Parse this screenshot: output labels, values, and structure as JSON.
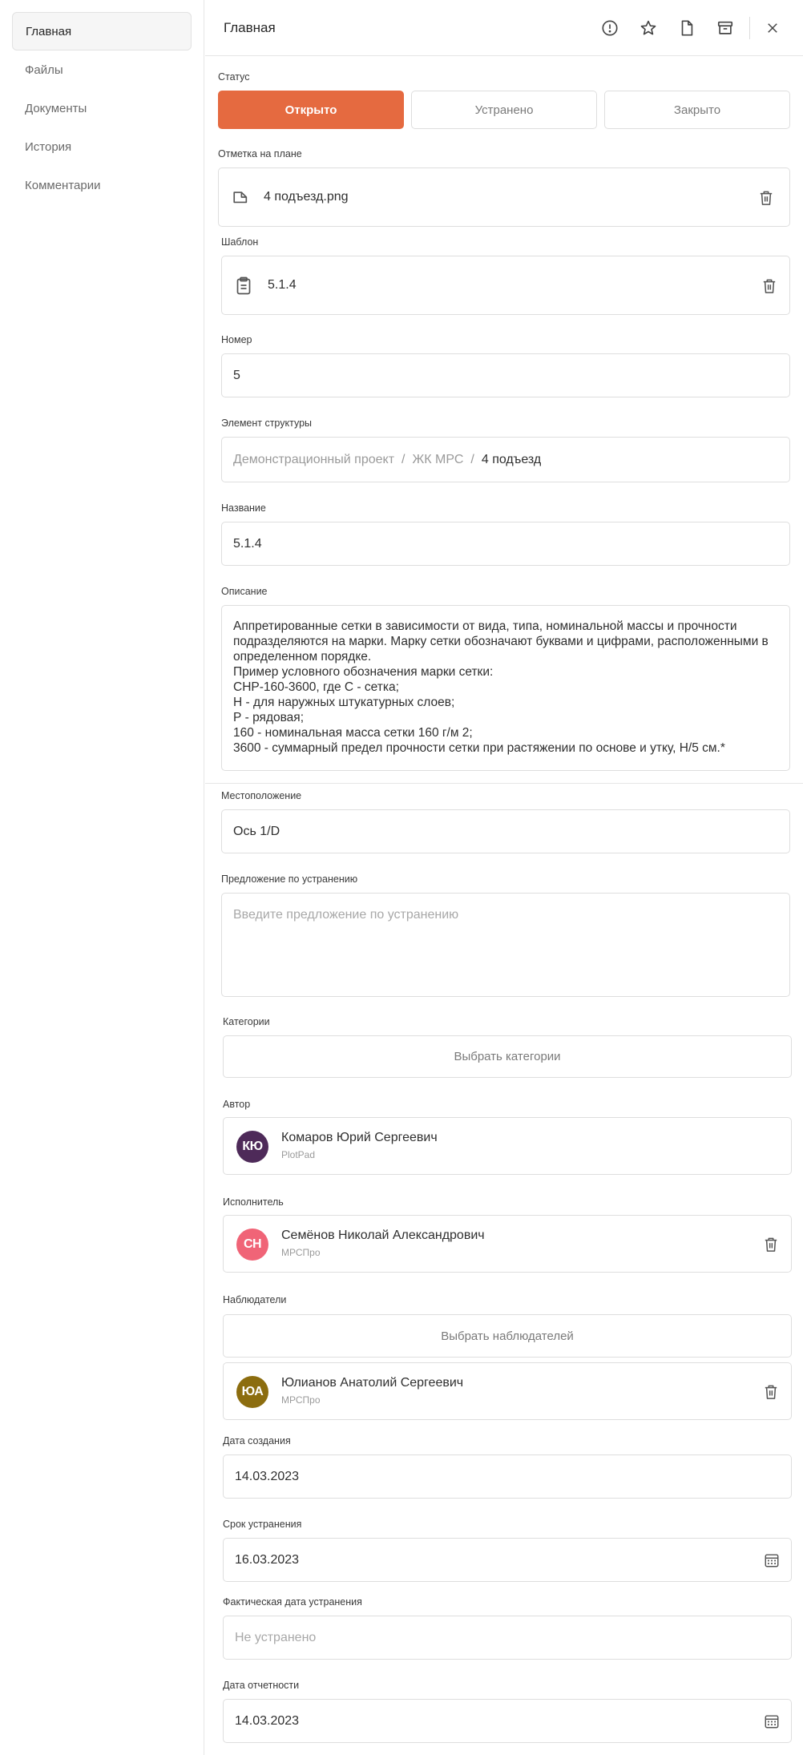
{
  "sidebar": {
    "items": [
      {
        "label": "Главная"
      },
      {
        "label": "Файлы"
      },
      {
        "label": "Документы"
      },
      {
        "label": "История"
      },
      {
        "label": "Комментарии"
      }
    ]
  },
  "header": {
    "title": "Главная",
    "icons": [
      "alert-circle-icon",
      "star-icon",
      "file-icon",
      "archive-icon",
      "close-icon"
    ]
  },
  "form": {
    "status": {
      "label": "Статус",
      "options": [
        "Открыто",
        "Устранено",
        "Закрыто"
      ],
      "selected": "Открыто"
    },
    "plan_mark": {
      "label": "Отметка на плане",
      "file": "4 подъезд.png"
    },
    "template": {
      "label": "Шаблон",
      "value": "5.1.4"
    },
    "number": {
      "label": "Номер",
      "value": "5"
    },
    "structure": {
      "label": "Элемент структуры",
      "path": [
        "Демонстрационный проект",
        "ЖК МРС",
        "4 подъезд"
      ],
      "separator": "/"
    },
    "name": {
      "label": "Название",
      "value": "5.1.4"
    },
    "description": {
      "label": "Описание",
      "value": "Аппретированные сетки в зависимости от вида, типа, номинальной массы и прочности подразделяются на марки. Марку сетки обозначают буквами и цифрами, расположенными в определенном порядке.\nПример условного обозначения марки сетки:\nСНР-160-3600, где С - сетка;\nН - для наружных штукатурных слоев;\nР - рядовая;\n160 - номинальная масса сетки 160 г/м 2;\n3600 - суммарный предел прочности сетки при растяжении по основе и утку, Н/5 см.*"
    },
    "location": {
      "label": "Местоположение",
      "value": "Ось 1/D"
    },
    "proposal": {
      "label": "Предложение по устранению",
      "placeholder": "Введите предложение по устранению"
    },
    "categories": {
      "label": "Категории",
      "button": "Выбрать категории"
    },
    "author": {
      "label": "Автор",
      "initials": "КЮ",
      "name": "Комаров Юрий Сергеевич",
      "org": "PlotPad",
      "color": "#4e2a59"
    },
    "executor": {
      "label": "Исполнитель",
      "initials": "СН",
      "name": "Семёнов Николай Александрович",
      "org": "МРСПро",
      "color": "#f06477"
    },
    "observers": {
      "label": "Наблюдатели",
      "button": "Выбрать наблюдателей",
      "items": [
        {
          "initials": "ЮА",
          "name": "Юлианов Анатолий Сергеевич",
          "org": "МРСПро",
          "color": "#8c6d0f"
        }
      ]
    },
    "created_date": {
      "label": "Дата создания",
      "value": "14.03.2023"
    },
    "due_date": {
      "label": "Срок устранения",
      "value": "16.03.2023"
    },
    "actual_date": {
      "label": "Фактическая дата устранения",
      "placeholder": "Не устранено"
    },
    "report_date": {
      "label": "Дата отчетности",
      "value": "14.03.2023"
    }
  },
  "colors": {
    "accent": "#e56a40",
    "border": "#dedede"
  }
}
